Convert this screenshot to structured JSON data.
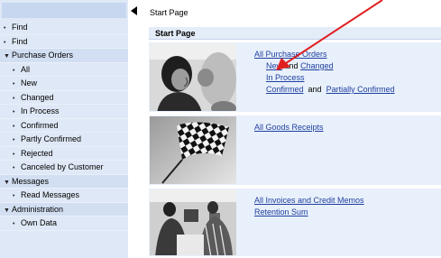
{
  "sidebar": {
    "items": [
      {
        "label": "Find",
        "level": 0,
        "marker": "bullet"
      },
      {
        "label": "Find",
        "level": 0,
        "marker": "bullet"
      },
      {
        "label": "Purchase Orders",
        "level": 0,
        "marker": "expanded"
      },
      {
        "label": "All",
        "level": 1,
        "marker": "bullet"
      },
      {
        "label": "New",
        "level": 1,
        "marker": "bullet"
      },
      {
        "label": "Changed",
        "level": 1,
        "marker": "bullet"
      },
      {
        "label": "In Process",
        "level": 1,
        "marker": "bullet"
      },
      {
        "label": "Confirmed",
        "level": 1,
        "marker": "bullet"
      },
      {
        "label": "Partly Confirmed",
        "level": 1,
        "marker": "bullet"
      },
      {
        "label": "Rejected",
        "level": 1,
        "marker": "bullet"
      },
      {
        "label": "Canceled by Customer",
        "level": 1,
        "marker": "bullet"
      },
      {
        "label": "Messages",
        "level": 0,
        "marker": "expanded"
      },
      {
        "label": "Read Messages",
        "level": 1,
        "marker": "bullet"
      },
      {
        "label": "Administration",
        "level": 0,
        "marker": "expanded"
      },
      {
        "label": "Own Data",
        "level": 1,
        "marker": "bullet"
      }
    ]
  },
  "breadcrumb": "Start Page",
  "page_title": "Start Page",
  "sections": {
    "purchase_orders": {
      "all": "All Purchase Orders",
      "new": "New",
      "and1": "and",
      "changed": "Changed",
      "in_process": "In Process",
      "confirmed": "Confirmed",
      "and2": "and",
      "partially_confirmed": "Partially Confirmed"
    },
    "goods_receipts": {
      "all": "All Goods Receipts"
    },
    "invoices": {
      "all": "All Invoices and Credit Memos",
      "retention": "Retention Sum"
    }
  },
  "colors": {
    "link": "#1f3f9f",
    "sidebar_bg": "#dfe8f6",
    "content_bg": "#e8f0fb",
    "annotation_arrow": "#e02020"
  },
  "icons": {
    "collapse": "collapse-left-icon",
    "annotation": "red-arrow-annotation"
  }
}
